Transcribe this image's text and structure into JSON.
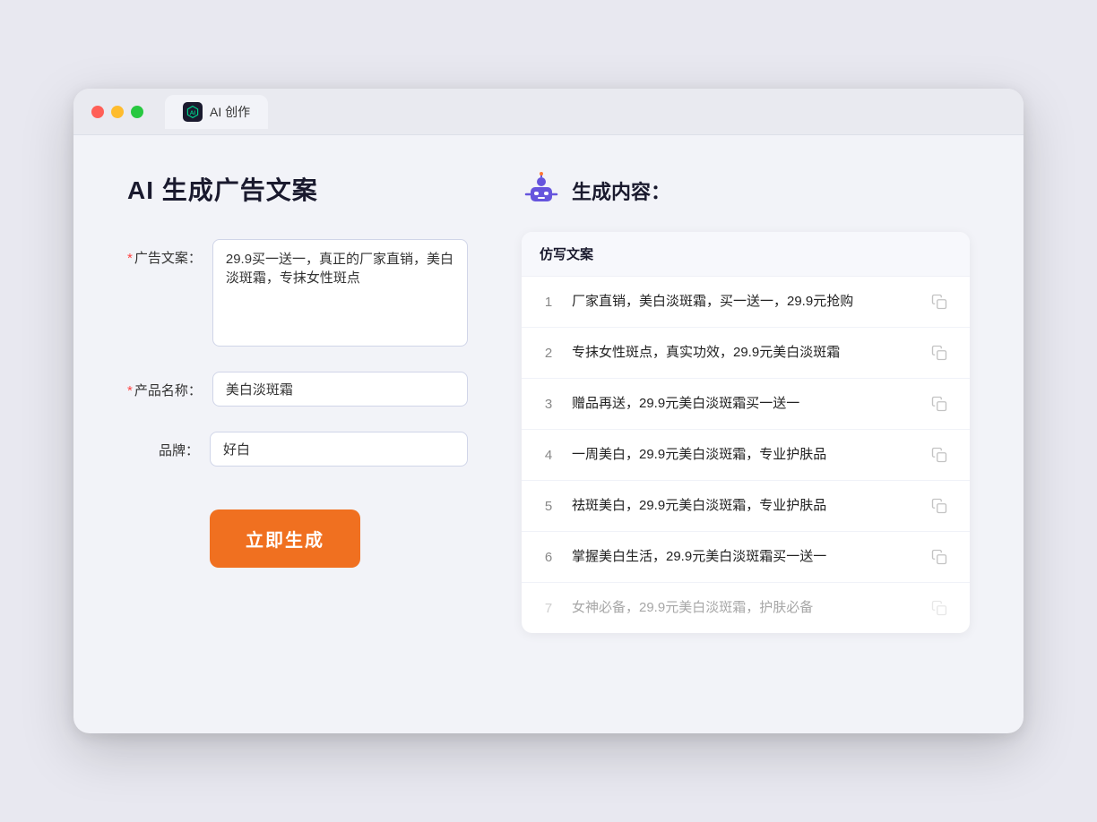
{
  "browser": {
    "tab_label": "AI 创作"
  },
  "page": {
    "title": "AI 生成广告文案",
    "right_title": "生成内容："
  },
  "form": {
    "ad_copy_label": "广告文案：",
    "ad_copy_value": "29.9买一送一，真正的厂家直销，美白淡斑霜，专抹女性斑点",
    "product_name_label": "产品名称：",
    "product_name_value": "美白淡斑霜",
    "brand_label": "品牌：",
    "brand_value": "好白",
    "generate_button": "立即生成"
  },
  "results": {
    "header": "仿写文案",
    "items": [
      {
        "id": 1,
        "text": "厂家直销，美白淡斑霜，买一送一，29.9元抢购",
        "faded": false
      },
      {
        "id": 2,
        "text": "专抹女性斑点，真实功效，29.9元美白淡斑霜",
        "faded": false
      },
      {
        "id": 3,
        "text": "赠品再送，29.9元美白淡斑霜买一送一",
        "faded": false
      },
      {
        "id": 4,
        "text": "一周美白，29.9元美白淡斑霜，专业护肤品",
        "faded": false
      },
      {
        "id": 5,
        "text": "祛斑美白，29.9元美白淡斑霜，专业护肤品",
        "faded": false
      },
      {
        "id": 6,
        "text": "掌握美白生活，29.9元美白淡斑霜买一送一",
        "faded": false
      },
      {
        "id": 7,
        "text": "女神必备，29.9元美白淡斑霜，护肤必备",
        "faded": true
      }
    ]
  }
}
